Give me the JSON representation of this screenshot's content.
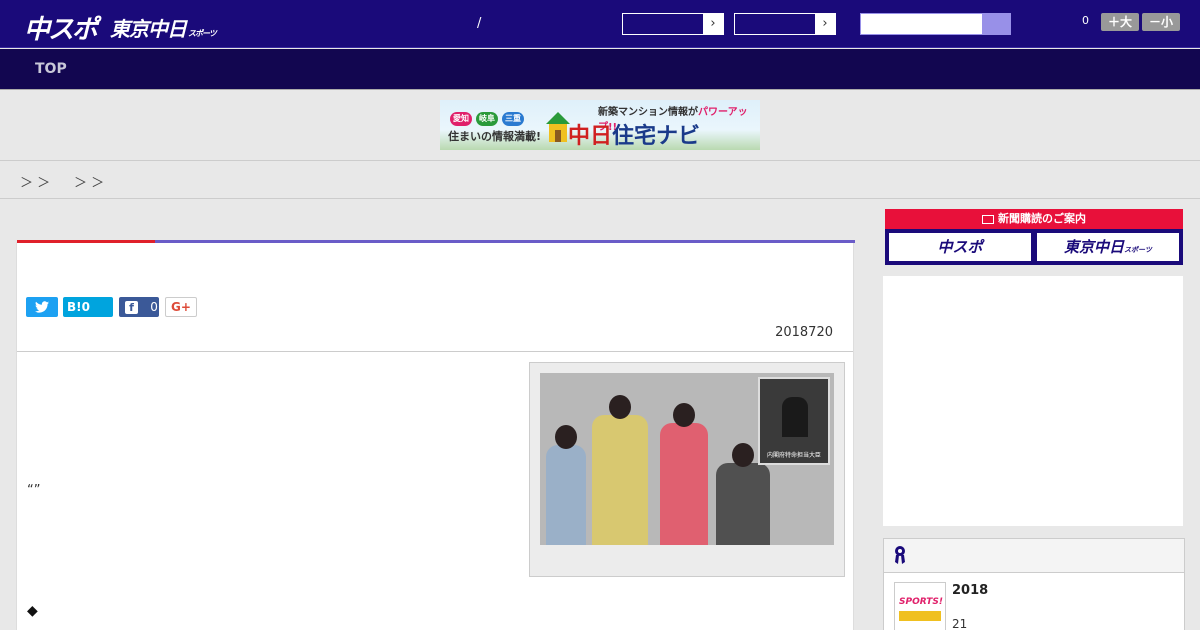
{
  "header": {
    "logo_chuspo": "中スポ",
    "logo_tokyo": "東京中日",
    "logo_tokyo_small": "スポーツ",
    "divider": "/",
    "select_arrow": "›",
    "notification_count": "0",
    "font_larger_label": "＋大",
    "font_smaller_label": "－小",
    "colors": {
      "header_bg": "#1a0a7a",
      "nav_bg": "#120650",
      "search_button": "#9890e8"
    }
  },
  "nav": {
    "top_label": "TOP"
  },
  "banner": {
    "pill_1": "愛知",
    "pill_2": "岐阜",
    "pill_3": "三重",
    "left_text": "住まいの情報満載!",
    "top_text": "新築マンション情報が",
    "top_highlight": "パワーアップ!!",
    "brand_red": "中日",
    "brand_blue": "住宅ナビ"
  },
  "breadcrumb": {
    "sep_1": "＞ ＞",
    "sep_2": "＞ ＞"
  },
  "article": {
    "social": {
      "twitter_icon": "twitter-bird",
      "hatena_label": "B!",
      "hatena_count": "0",
      "facebook_label": "f",
      "facebook_count": "0",
      "gplus_label": "G+"
    },
    "date": "2018720",
    "quote_text": "“”",
    "bullet": "◆",
    "photo_inset_caption": "内閣府特命担当大臣"
  },
  "sidebar": {
    "subscribe_header": "新聞購読のご案内",
    "subscribe_chuspo": "中スポ",
    "subscribe_tokyo": "東京中日",
    "subscribe_tokyo_small": "スポーツ",
    "ranking": {
      "title": "2018",
      "subtitle": "21",
      "thumb_text": "SPORTS!"
    }
  }
}
